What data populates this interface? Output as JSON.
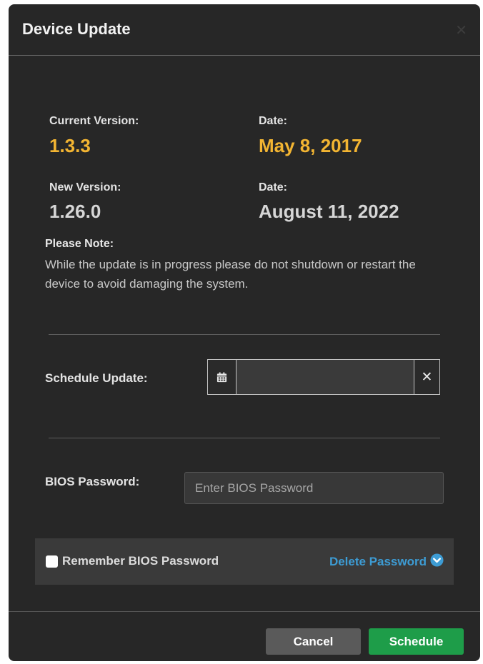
{
  "dialog": {
    "title": "Device Update",
    "close_icon": "close-icon"
  },
  "versions": {
    "current_label": "Current Version:",
    "current_value": "1.3.3",
    "current_date_label": "Date:",
    "current_date_value": "May 8, 2017",
    "new_label": "New Version:",
    "new_value": "1.26.0",
    "new_date_label": "Date:",
    "new_date_value": "August 11, 2022"
  },
  "note": {
    "title": "Please Note:",
    "text": "While the update is in progress please do not shutdown or restart the device to avoid damaging the system."
  },
  "schedule": {
    "label": "Schedule Update:",
    "value": "",
    "calendar_icon": "calendar-icon",
    "clear_icon": "clear-icon"
  },
  "bios": {
    "label": "BIOS Password:",
    "placeholder": "Enter BIOS Password",
    "value": "",
    "remember_label": "Remember BIOS Password",
    "remember_checked": false,
    "delete_label": "Delete Password",
    "delete_icon": "chevron-down-circle-icon"
  },
  "footer": {
    "cancel_label": "Cancel",
    "schedule_label": "Schedule"
  },
  "colors": {
    "dialog_bg": "#272727",
    "accent_current": "#f3b532",
    "link": "#3d9cd4",
    "primary_button": "#1e9d49",
    "secondary_button": "#5a5a5a"
  }
}
